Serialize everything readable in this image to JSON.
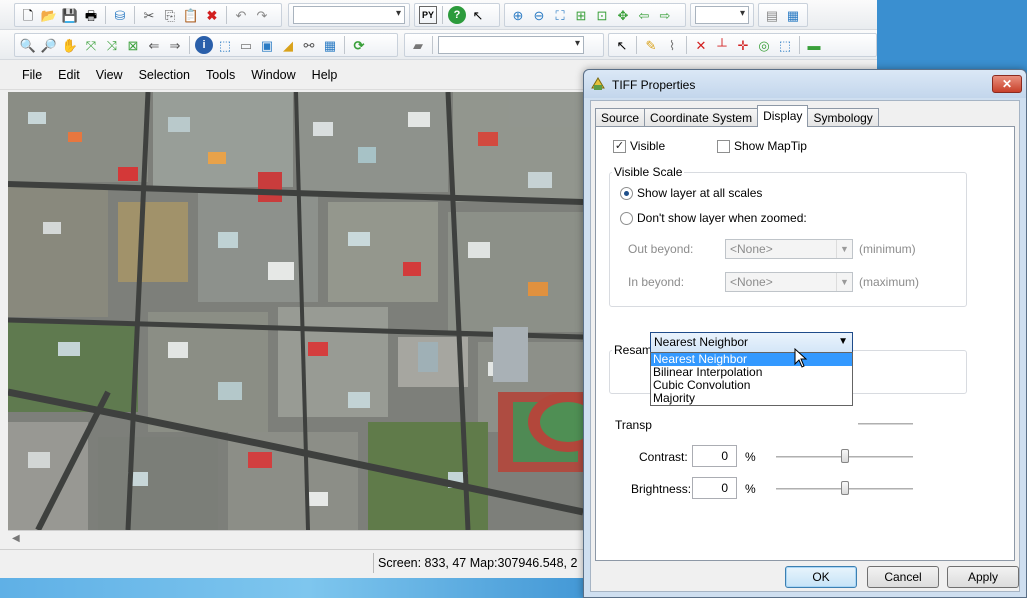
{
  "toolbar": {
    "row1_icons": [
      "new-icon",
      "open-icon",
      "save-icon",
      "print-icon",
      "sep",
      "layer-icon",
      "sep",
      "cut-icon",
      "copy-icon",
      "paste-icon",
      "delete-icon",
      "sep",
      "undo-icon",
      "redo-icon"
    ],
    "row2_icons": [
      "zoom-in-icon",
      "zoom-out-icon",
      "pan-icon",
      "full-extent-icon",
      "fixed-zoom-icon",
      "zoom-layer-icon",
      "back-icon",
      "forward-icon",
      "sep",
      "identify-icon",
      "select-icon",
      "clear-select-icon",
      "measure-icon",
      "fill-icon",
      "hyperlink-icon",
      "table-icon",
      "sep",
      "refresh-icon"
    ]
  },
  "menu": {
    "file": "File",
    "edit": "Edit",
    "view": "View",
    "selection": "Selection",
    "tools": "Tools",
    "window": "Window",
    "help": "Help"
  },
  "status": {
    "text": "Screen: 833, 47  Map:307946.548, 2"
  },
  "dialog": {
    "title": "TIFF  Properties",
    "close": "✕",
    "tabs": {
      "source": "Source",
      "coordinate_system": "Coordinate System",
      "display": "Display",
      "symbology": "Symbology"
    },
    "visible_label": "Visible",
    "visible_checked": "✓",
    "show_maptip_label": "Show MapTip",
    "visible_scale": {
      "label": "Visible Scale",
      "all_scales": "Show layer at all scales",
      "when_zoomed": "Don't show layer when zoomed:",
      "out_beyond_label": "Out beyond:",
      "out_beyond_value": "<None>",
      "out_beyond_hint": "(minimum)",
      "in_beyond_label": "In beyond:",
      "in_beyond_value": "<None>",
      "in_beyond_hint": "(maximum)"
    },
    "resample": {
      "label": "Resample Method",
      "selected": "Nearest Neighbor",
      "options": [
        "Nearest Neighbor",
        "Bilinear Interpolation",
        "Cubic Convolution",
        "Majority"
      ]
    },
    "transparency_label": "Transp",
    "contrast_label": "Contrast:",
    "contrast_value": "0",
    "contrast_unit": "%",
    "contrast_level": 0.5,
    "brightness_label": "Brightness:",
    "brightness_value": "0",
    "brightness_unit": "%",
    "brightness_level": 0.5,
    "buttons": {
      "ok": "OK",
      "cancel": "Cancel",
      "apply": "Apply"
    }
  }
}
